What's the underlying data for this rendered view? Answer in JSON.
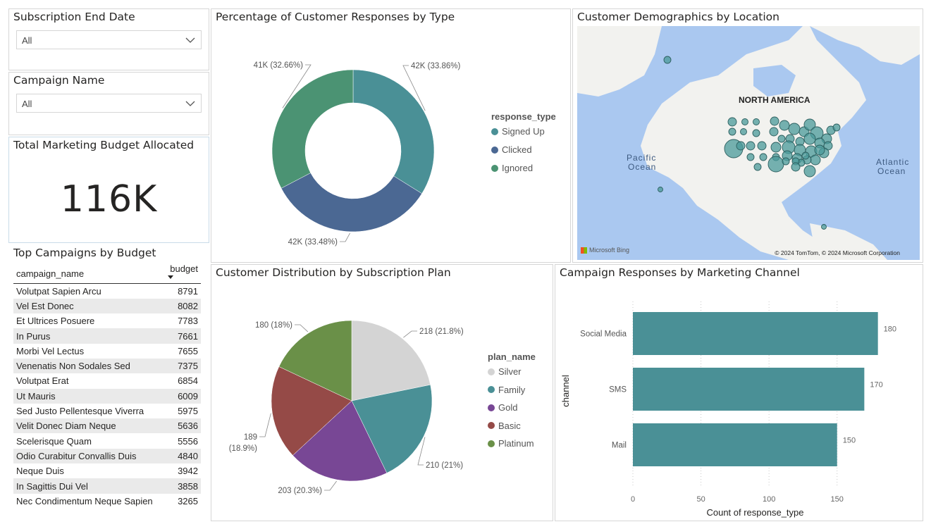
{
  "slicer_end_date": {
    "title": "Subscription End Date",
    "value": "All"
  },
  "slicer_campaign": {
    "title": "Campaign Name",
    "value": "All"
  },
  "card_budget": {
    "title": "Total Marketing Budget Allocated",
    "value": "116K"
  },
  "top_campaigns": {
    "title": "Top Campaigns by Budget",
    "col_name": "campaign_name",
    "col_budget": "budget",
    "rows": [
      {
        "name": "Volutpat Sapien Arcu",
        "budget": "8791"
      },
      {
        "name": "Vel Est Donec",
        "budget": "8082"
      },
      {
        "name": "Et Ultrices Posuere",
        "budget": "7783"
      },
      {
        "name": "In Purus",
        "budget": "7661"
      },
      {
        "name": "Morbi Vel Lectus",
        "budget": "7655"
      },
      {
        "name": "Venenatis Non Sodales Sed",
        "budget": "7375"
      },
      {
        "name": "Volutpat Erat",
        "budget": "6854"
      },
      {
        "name": "Ut Mauris",
        "budget": "6009"
      },
      {
        "name": "Sed Justo Pellentesque Viverra",
        "budget": "5975"
      },
      {
        "name": "Velit Donec Diam Neque",
        "budget": "5636"
      },
      {
        "name": "Scelerisque Quam",
        "budget": "5556"
      },
      {
        "name": "Odio Curabitur Convallis Duis",
        "budget": "4840"
      },
      {
        "name": "Neque Duis",
        "budget": "3942"
      },
      {
        "name": "In Sagittis Dui Vel",
        "budget": "3858"
      },
      {
        "name": "Nec Condimentum Neque Sapien",
        "budget": "3265"
      }
    ]
  },
  "donut_panel": {
    "title": "Percentage of Customer Responses by Type",
    "legend_title": "response_type"
  },
  "map_panel": {
    "title": "Customer Demographics by Location",
    "labels": {
      "continent": "NORTH AMERICA",
      "pacific_1": "Pacific",
      "pacific_2": "Ocean",
      "atlantic_1": "Atlantic",
      "atlantic_2": "Ocean"
    },
    "attribution": "© 2024 TomTom, © 2024 Microsoft Corporation",
    "logo": "Microsoft Bing",
    "land_color": "#f2f2ef",
    "water_color": "#aac8f0",
    "bubble_color": "#4a9a9a"
  },
  "pie_panel": {
    "title": "Customer Distribution by Subscription Plan",
    "legend_title": "plan_name"
  },
  "bar_panel": {
    "title": "Campaign Responses by Marketing Channel",
    "xlabel": "Count of response_type",
    "ylabel": "channel"
  },
  "chart_data": [
    {
      "type": "pie",
      "variant": "donut",
      "title": "Percentage of Customer Responses by Type",
      "legend_title": "response_type",
      "legend_position": "right",
      "categories": [
        "Signed Up",
        "Clicked",
        "Ignored"
      ],
      "values": [
        33.86,
        33.48,
        32.66
      ],
      "data_labels": [
        "42K (33.86%)",
        "42K (33.48%)",
        "41K (32.66%)"
      ],
      "colors": [
        "#4a9096",
        "#4b6893",
        "#4b9373"
      ]
    },
    {
      "type": "pie",
      "title": "Customer Distribution by Subscription Plan",
      "legend_title": "plan_name",
      "legend_position": "right",
      "categories": [
        "Silver",
        "Family",
        "Gold",
        "Basic",
        "Platinum"
      ],
      "values": [
        218,
        210,
        203,
        189,
        180
      ],
      "data_labels": [
        "218 (21.8%)",
        "210 (21%)",
        "203 (20.3%)",
        "189 (18.9%)",
        "180 (18%)"
      ],
      "colors": [
        "#d4d4d4",
        "#4a9096",
        "#784795",
        "#954a47",
        "#6a9048"
      ]
    },
    {
      "type": "bar",
      "orientation": "horizontal",
      "title": "Campaign Responses by Marketing Channel",
      "categories": [
        "Social Media",
        "SMS",
        "Mail"
      ],
      "values": [
        180,
        170,
        150
      ],
      "xlabel": "Count of response_type",
      "ylabel": "channel",
      "xlim": [
        0,
        190
      ],
      "xticks": [
        0,
        50,
        100,
        150
      ],
      "grid": true,
      "color": "#4a9096"
    }
  ]
}
